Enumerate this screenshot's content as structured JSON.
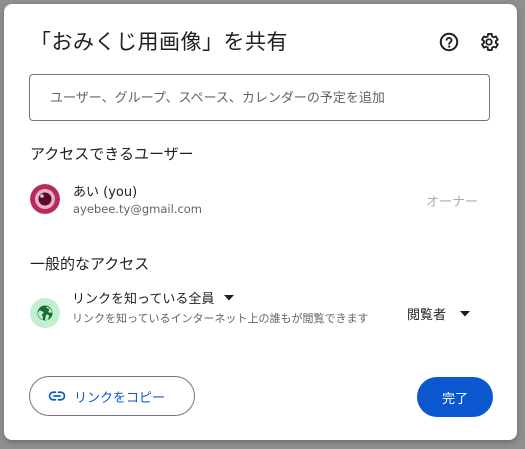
{
  "dialog": {
    "title": "「おみくじ用画像」を共有"
  },
  "search": {
    "placeholder": "ユーザー、グループ、スペース、カレンダーの予定を追加"
  },
  "people_section": {
    "title": "アクセスできるユーザー",
    "users": [
      {
        "name": "あい (you)",
        "email": "ayebee.ty@gmail.com",
        "role": "オーナー"
      }
    ]
  },
  "general_access": {
    "title": "一般的なアクセス",
    "scope": "リンクを知っている全員",
    "description": "リンクを知っているインターネット上の誰もが閲覧できます",
    "role": "閲覧者"
  },
  "footer": {
    "copy_link_label": "リンクをコピー",
    "done_label": "完了"
  },
  "colors": {
    "accent": "#0b57d0",
    "globe_bg": "#c4eed0",
    "globe_fg": "#146c2e",
    "avatar": "#b82a5c"
  },
  "icons": {
    "help": "help-icon",
    "settings": "gear-icon",
    "globe": "globe-icon",
    "link": "link-icon",
    "dropdown": "chevron-down-icon"
  }
}
